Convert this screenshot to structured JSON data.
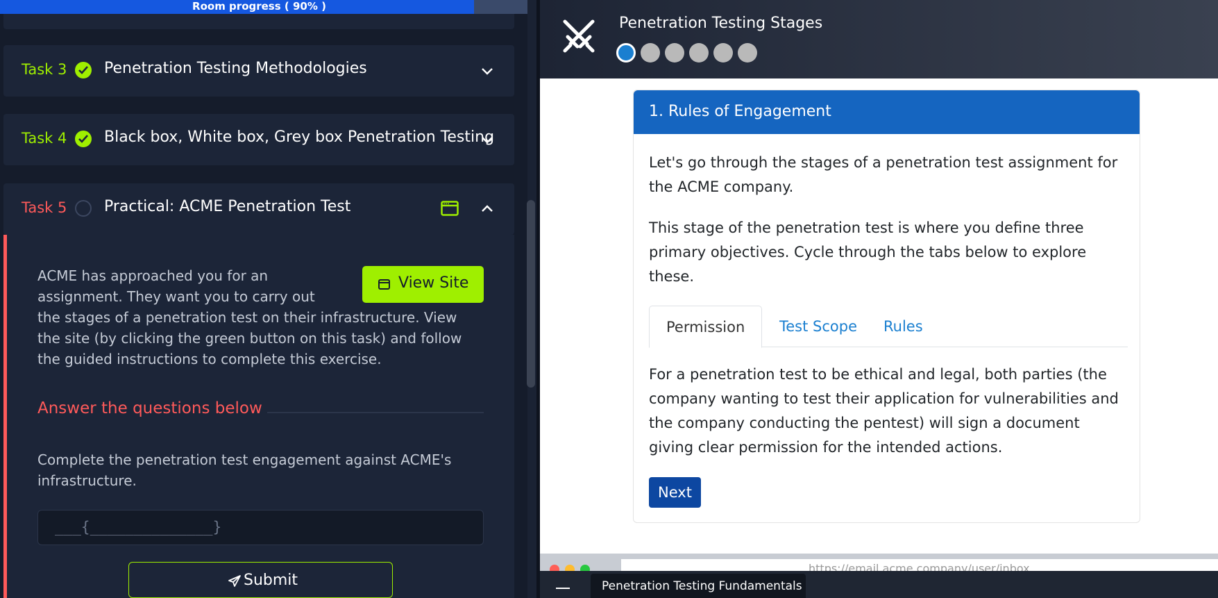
{
  "progress": {
    "label": "Room progress ( 90% )",
    "percent": 90
  },
  "tasks": [
    {
      "number": "Task 3",
      "title": "Penetration Testing Methodologies",
      "status": "complete"
    },
    {
      "number": "Task 4",
      "title": "Black box, White box, Grey box Penetration Testing",
      "status": "complete"
    },
    {
      "number": "Task 5",
      "title": "Practical: ACME Penetration Test",
      "status": "incomplete"
    }
  ],
  "task5": {
    "description": "ACME has approached you for an assignment. They want you to carry out the stages of a penetration test on their infrastructure. View the site (by clicking the green button on this task) and follow the guided instructions to complete this exercise.",
    "view_site_label": "View Site",
    "answer_heading": "Answer the questions below",
    "question": "Complete the penetration test engagement against ACME's infrastructure.",
    "answer_placeholder": "___{______________}",
    "submit_label": "Submit"
  },
  "site": {
    "title": "Penetration Testing Stages",
    "steps_total": 6,
    "current_step": 1,
    "card_title": "1. Rules of Engagement",
    "para1": "Let's go through the stages of a penetration test assignment for the ACME company.",
    "para2": "This stage of the penetration test is where you define three primary objectives. Cycle through the tabs below to explore these.",
    "tabs": [
      "Permission",
      "Test Scope",
      "Rules"
    ],
    "active_tab": "Permission",
    "tab_content": "For a penetration test to be ethical and legal, both parties (the company wanting to test their application for vulnerabilities and the company conducting the pentest) will sign a document giving clear permission for the intended actions.",
    "next_label": "Next",
    "url": "https://email.acme.company/user/inbox"
  },
  "taskbar": {
    "tab_label": "Penetration Testing Fundamentals"
  },
  "colors": {
    "accent_green": "#9fef00",
    "accent_red": "#ff5a5a",
    "progress_blue": "#1558e0",
    "site_blue": "#1565c0"
  }
}
